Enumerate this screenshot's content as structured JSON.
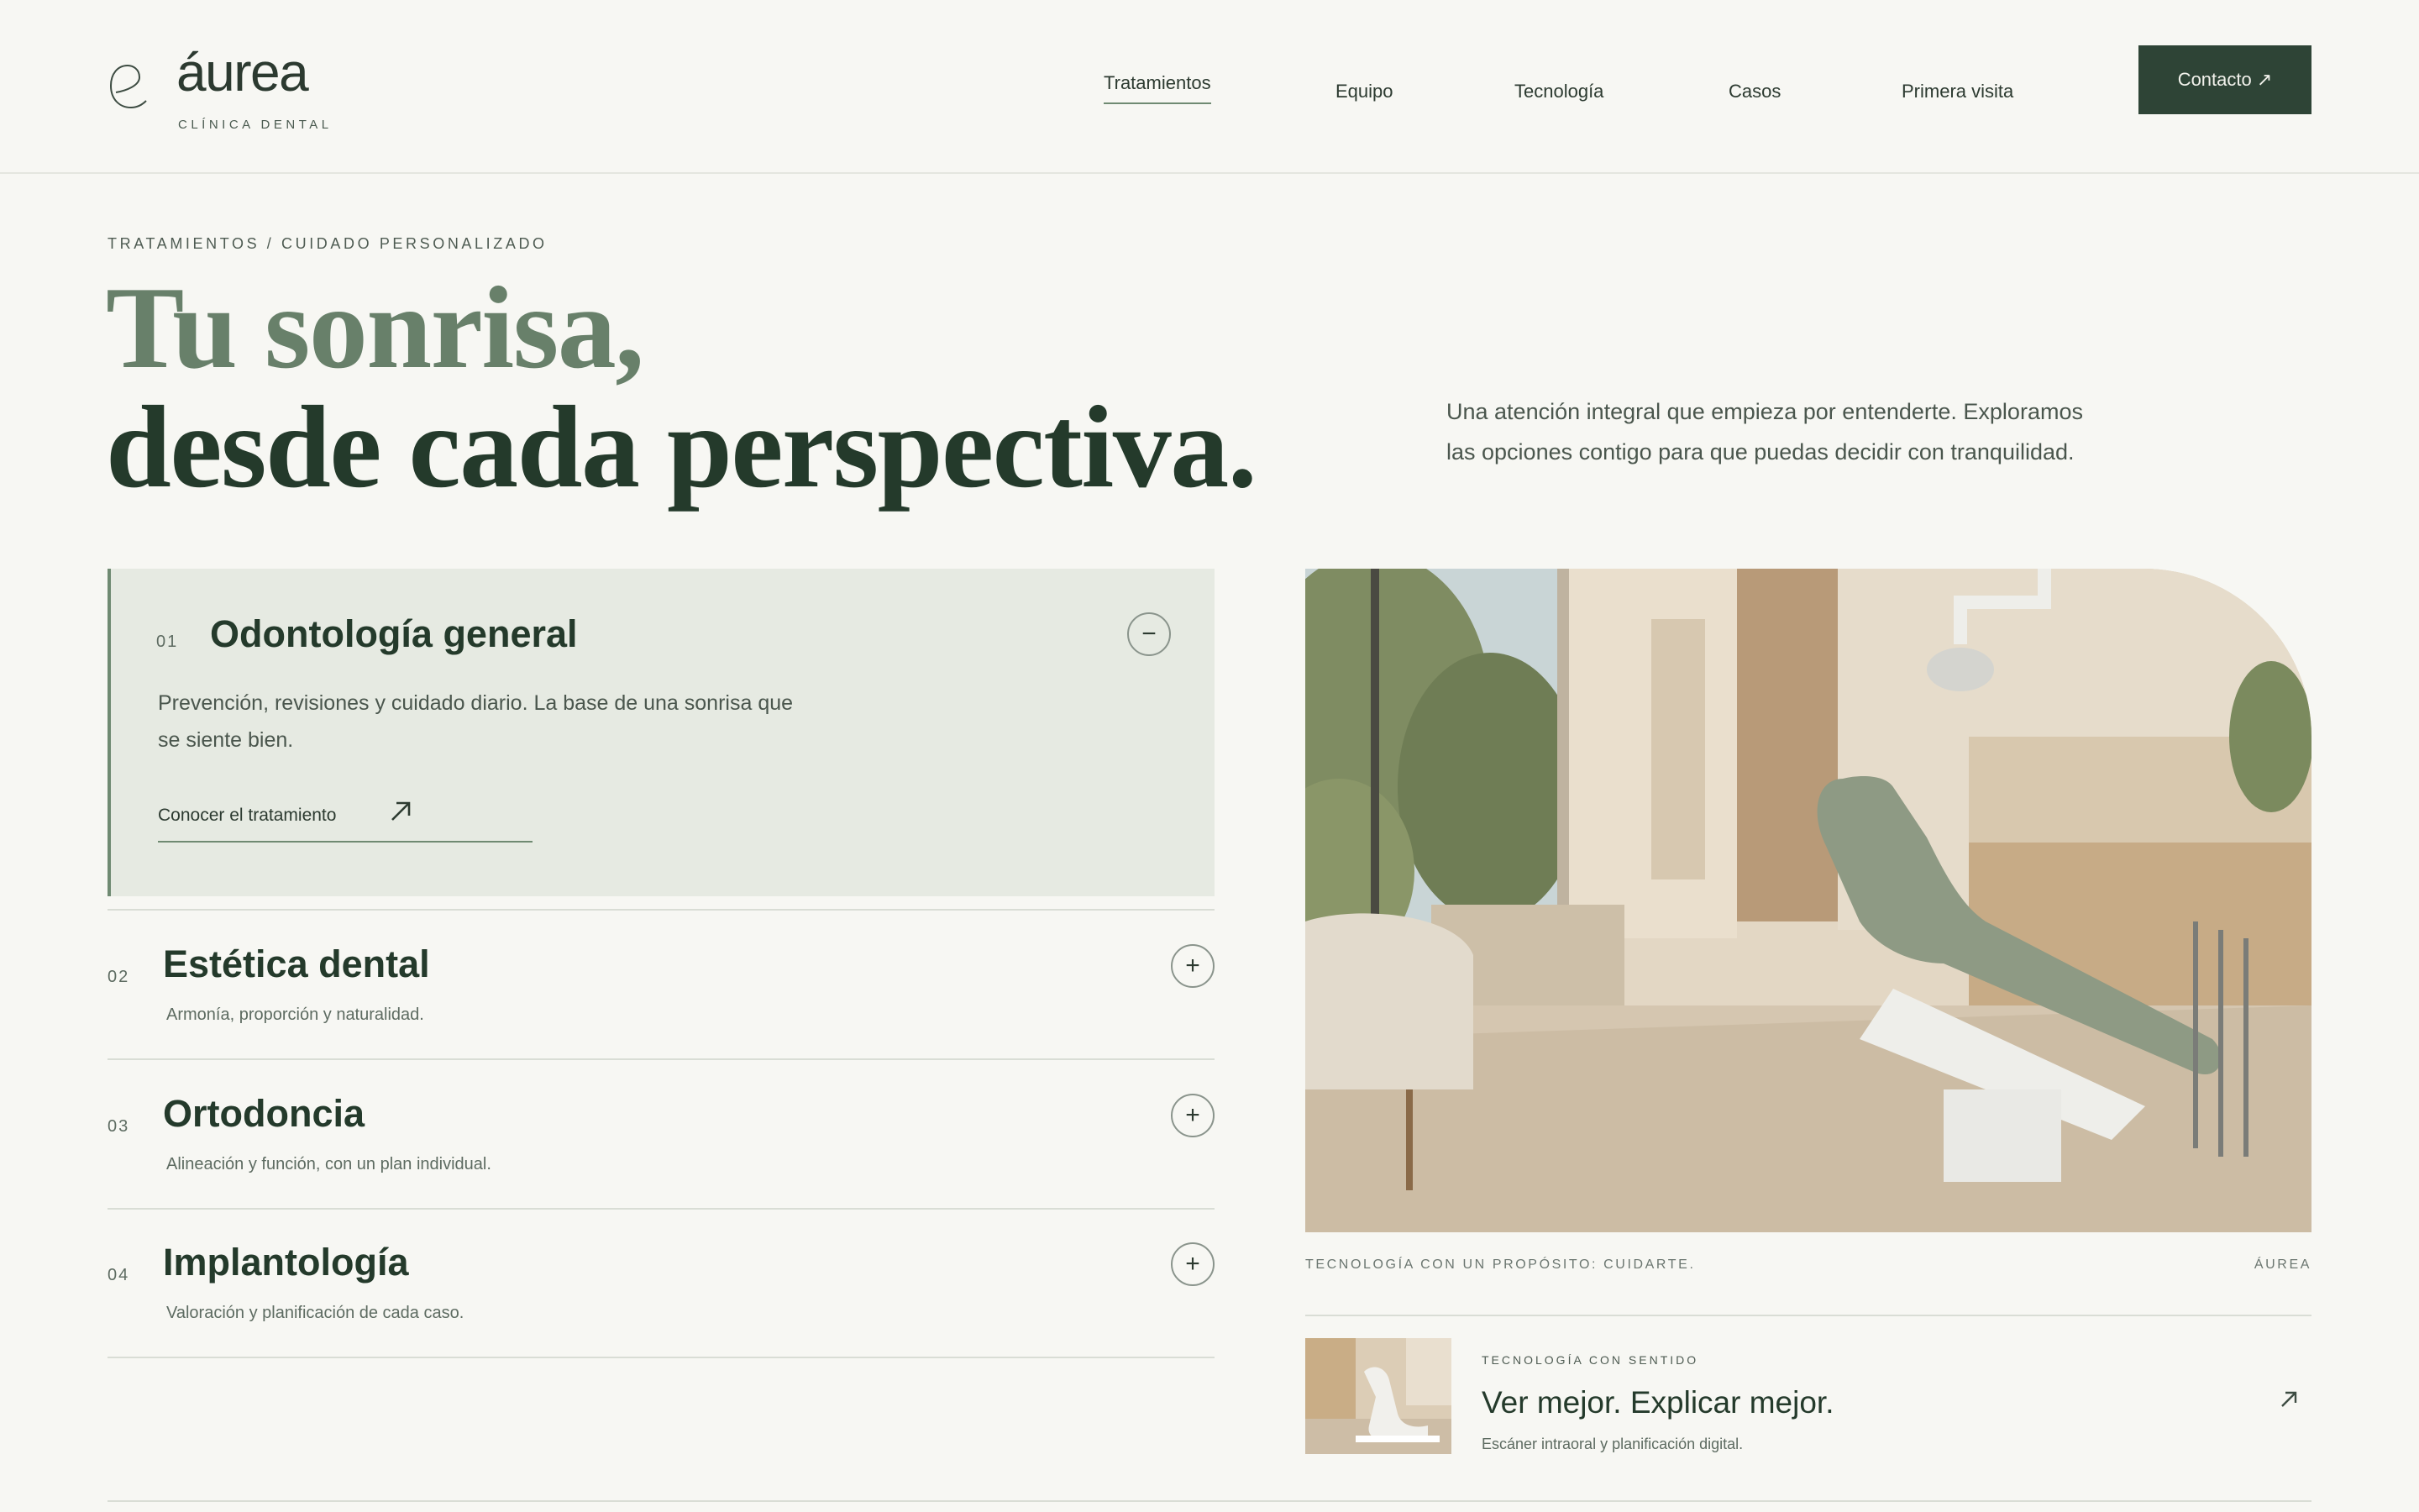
{
  "brand": {
    "name": "áurea",
    "tagline": "CLÍNICA DENTAL"
  },
  "nav": {
    "items": [
      {
        "label": "Tratamientos",
        "active": true
      },
      {
        "label": "Equipo",
        "active": false
      },
      {
        "label": "Tecnología",
        "active": false
      },
      {
        "label": "Casos",
        "active": false
      },
      {
        "label": "Primera visita",
        "active": false
      }
    ],
    "contact_label": "Contacto ↗"
  },
  "hero": {
    "breadcrumb": "TRATAMIENTOS / CUIDADO PERSONALIZADO",
    "title_line1": "Tu sonrisa,",
    "title_line2": "desde cada perspectiva.",
    "intro": "Una atención integral que empieza por entenderte. Exploramos las opciones contigo para que puedas decidir con tranquilidad."
  },
  "treatments": [
    {
      "number": "01",
      "name": "Odontología general",
      "description": "Prevención, revisiones y cuidado diario. La base de una sonrisa que se siente bien.",
      "link_label": "Conocer el tratamiento",
      "expanded": true,
      "toggle": "−"
    },
    {
      "number": "02",
      "name": "Estética dental",
      "summary": "Armonía, proporción y naturalidad.",
      "expanded": false,
      "toggle": "+"
    },
    {
      "number": "03",
      "name": "Ortodoncia",
      "summary": "Alineación y función, con un plan individual.",
      "expanded": false,
      "toggle": "+"
    },
    {
      "number": "04",
      "name": "Implantología",
      "summary": "Valoración y planificación de cada caso.",
      "expanded": false,
      "toggle": "+"
    }
  ],
  "photo": {
    "caption": "TECNOLOGÍA CON UN PROPÓSITO: CUIDARTE.",
    "brand": "ÁUREA"
  },
  "tech_card": {
    "eyebrow": "TECNOLOGÍA CON SENTIDO",
    "title": "Ver mejor. Explicar mejor.",
    "subtitle": "Escáner intraoral y planificación digital."
  },
  "colors": {
    "background": "#f7f7f3",
    "primary_dark": "#2e4436",
    "sage": "#68806a",
    "panel": "#e6eae2"
  }
}
